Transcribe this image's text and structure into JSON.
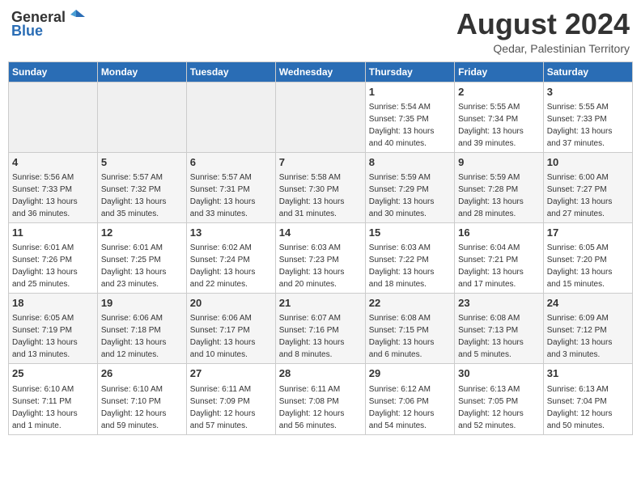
{
  "header": {
    "logo_general": "General",
    "logo_blue": "Blue",
    "month_year": "August 2024",
    "location": "Qedar, Palestinian Territory"
  },
  "weekdays": [
    "Sunday",
    "Monday",
    "Tuesday",
    "Wednesday",
    "Thursday",
    "Friday",
    "Saturday"
  ],
  "weeks": [
    [
      {
        "day": "",
        "info": ""
      },
      {
        "day": "",
        "info": ""
      },
      {
        "day": "",
        "info": ""
      },
      {
        "day": "",
        "info": ""
      },
      {
        "day": "1",
        "info": "Sunrise: 5:54 AM\nSunset: 7:35 PM\nDaylight: 13 hours\nand 40 minutes."
      },
      {
        "day": "2",
        "info": "Sunrise: 5:55 AM\nSunset: 7:34 PM\nDaylight: 13 hours\nand 39 minutes."
      },
      {
        "day": "3",
        "info": "Sunrise: 5:55 AM\nSunset: 7:33 PM\nDaylight: 13 hours\nand 37 minutes."
      }
    ],
    [
      {
        "day": "4",
        "info": "Sunrise: 5:56 AM\nSunset: 7:33 PM\nDaylight: 13 hours\nand 36 minutes."
      },
      {
        "day": "5",
        "info": "Sunrise: 5:57 AM\nSunset: 7:32 PM\nDaylight: 13 hours\nand 35 minutes."
      },
      {
        "day": "6",
        "info": "Sunrise: 5:57 AM\nSunset: 7:31 PM\nDaylight: 13 hours\nand 33 minutes."
      },
      {
        "day": "7",
        "info": "Sunrise: 5:58 AM\nSunset: 7:30 PM\nDaylight: 13 hours\nand 31 minutes."
      },
      {
        "day": "8",
        "info": "Sunrise: 5:59 AM\nSunset: 7:29 PM\nDaylight: 13 hours\nand 30 minutes."
      },
      {
        "day": "9",
        "info": "Sunrise: 5:59 AM\nSunset: 7:28 PM\nDaylight: 13 hours\nand 28 minutes."
      },
      {
        "day": "10",
        "info": "Sunrise: 6:00 AM\nSunset: 7:27 PM\nDaylight: 13 hours\nand 27 minutes."
      }
    ],
    [
      {
        "day": "11",
        "info": "Sunrise: 6:01 AM\nSunset: 7:26 PM\nDaylight: 13 hours\nand 25 minutes."
      },
      {
        "day": "12",
        "info": "Sunrise: 6:01 AM\nSunset: 7:25 PM\nDaylight: 13 hours\nand 23 minutes."
      },
      {
        "day": "13",
        "info": "Sunrise: 6:02 AM\nSunset: 7:24 PM\nDaylight: 13 hours\nand 22 minutes."
      },
      {
        "day": "14",
        "info": "Sunrise: 6:03 AM\nSunset: 7:23 PM\nDaylight: 13 hours\nand 20 minutes."
      },
      {
        "day": "15",
        "info": "Sunrise: 6:03 AM\nSunset: 7:22 PM\nDaylight: 13 hours\nand 18 minutes."
      },
      {
        "day": "16",
        "info": "Sunrise: 6:04 AM\nSunset: 7:21 PM\nDaylight: 13 hours\nand 17 minutes."
      },
      {
        "day": "17",
        "info": "Sunrise: 6:05 AM\nSunset: 7:20 PM\nDaylight: 13 hours\nand 15 minutes."
      }
    ],
    [
      {
        "day": "18",
        "info": "Sunrise: 6:05 AM\nSunset: 7:19 PM\nDaylight: 13 hours\nand 13 minutes."
      },
      {
        "day": "19",
        "info": "Sunrise: 6:06 AM\nSunset: 7:18 PM\nDaylight: 13 hours\nand 12 minutes."
      },
      {
        "day": "20",
        "info": "Sunrise: 6:06 AM\nSunset: 7:17 PM\nDaylight: 13 hours\nand 10 minutes."
      },
      {
        "day": "21",
        "info": "Sunrise: 6:07 AM\nSunset: 7:16 PM\nDaylight: 13 hours\nand 8 minutes."
      },
      {
        "day": "22",
        "info": "Sunrise: 6:08 AM\nSunset: 7:15 PM\nDaylight: 13 hours\nand 6 minutes."
      },
      {
        "day": "23",
        "info": "Sunrise: 6:08 AM\nSunset: 7:13 PM\nDaylight: 13 hours\nand 5 minutes."
      },
      {
        "day": "24",
        "info": "Sunrise: 6:09 AM\nSunset: 7:12 PM\nDaylight: 13 hours\nand 3 minutes."
      }
    ],
    [
      {
        "day": "25",
        "info": "Sunrise: 6:10 AM\nSunset: 7:11 PM\nDaylight: 13 hours\nand 1 minute."
      },
      {
        "day": "26",
        "info": "Sunrise: 6:10 AM\nSunset: 7:10 PM\nDaylight: 12 hours\nand 59 minutes."
      },
      {
        "day": "27",
        "info": "Sunrise: 6:11 AM\nSunset: 7:09 PM\nDaylight: 12 hours\nand 57 minutes."
      },
      {
        "day": "28",
        "info": "Sunrise: 6:11 AM\nSunset: 7:08 PM\nDaylight: 12 hours\nand 56 minutes."
      },
      {
        "day": "29",
        "info": "Sunrise: 6:12 AM\nSunset: 7:06 PM\nDaylight: 12 hours\nand 54 minutes."
      },
      {
        "day": "30",
        "info": "Sunrise: 6:13 AM\nSunset: 7:05 PM\nDaylight: 12 hours\nand 52 minutes."
      },
      {
        "day": "31",
        "info": "Sunrise: 6:13 AM\nSunset: 7:04 PM\nDaylight: 12 hours\nand 50 minutes."
      }
    ]
  ]
}
